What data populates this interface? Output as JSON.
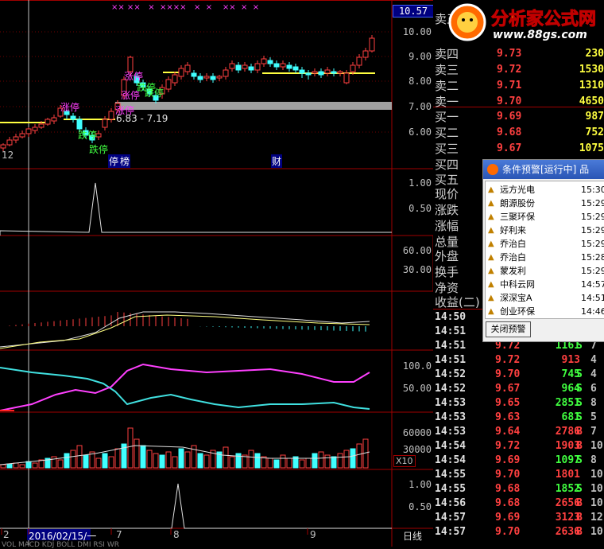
{
  "top_price_badge": "10.57",
  "top_markers": "×× ××   ×  ××××   ×  ×    ××  ×  ×",
  "main_axis": [
    "10.00",
    "9.00",
    "8.00",
    "7.00",
    "6.00"
  ],
  "vol_axis1": [
    "1.00",
    "0.50"
  ],
  "axis3": [
    "60.00",
    "30.00"
  ],
  "axis5": [
    "100.0",
    "50.00"
  ],
  "vol_axis": [
    "60000",
    "30000"
  ],
  "vol_unit": "X10",
  "axis7": [
    "1.00",
    "0.50"
  ],
  "chart_labels": {
    "range": "6.83 - 7.19",
    "left_num": "12",
    "tags": [
      "停",
      "涨停",
      "涨停",
      "涨停",
      "涨停",
      "跌停",
      "跌停",
      "跌停",
      "跌停",
      "涨停",
      "跌停"
    ],
    "bottom_tags": [
      "停",
      "榜",
      "财"
    ]
  },
  "bottom_bar": {
    "date": "2016/02/15/一",
    "ticks": [
      "2",
      "3",
      "7",
      "8",
      "9"
    ],
    "period": "日线",
    "indicators": "VOL  MACD  KDJ  BOLL  DMI  RSI  WR"
  },
  "quote": {
    "rows": [
      {
        "label": "卖五",
        "price": "",
        "vol": ""
      },
      {
        "label": "卖四",
        "price": "9.73",
        "vol": "230"
      },
      {
        "label": "卖三",
        "price": "9.72",
        "vol": "1530"
      },
      {
        "label": "卖二",
        "price": "9.71",
        "vol": "1310"
      },
      {
        "label": "卖一",
        "price": "9.70",
        "vol": "4650"
      },
      {
        "label": "买一",
        "price": "9.69",
        "vol": "987"
      },
      {
        "label": "买二",
        "price": "9.68",
        "vol": "752"
      },
      {
        "label": "买三",
        "price": "9.67",
        "vol": "1075"
      },
      {
        "label": "买四",
        "price": "",
        "vol": ""
      },
      {
        "label": "买五",
        "price": "",
        "vol": ""
      },
      {
        "label": "现价",
        "price": "",
        "vol": ""
      },
      {
        "label": "涨跌",
        "price": "",
        "vol": ""
      },
      {
        "label": "涨幅",
        "price": "",
        "vol": ""
      },
      {
        "label": "总量",
        "price": "",
        "vol": ""
      },
      {
        "label": "外盘",
        "price": "",
        "vol": ""
      },
      {
        "label": "换手",
        "price": "",
        "vol": ""
      },
      {
        "label": "净资",
        "price": "",
        "vol": ""
      },
      {
        "label": "收益(二)",
        "price": "",
        "vol": ""
      }
    ],
    "ticks": [
      {
        "time": "14:50",
        "price": "",
        "vol": "",
        "bs": "",
        "n": ""
      },
      {
        "time": "14:51",
        "price": "",
        "vol": "",
        "bs": "",
        "n": ""
      },
      {
        "time": "14:51",
        "price": "9.72",
        "vol": "1161",
        "bs": "S",
        "n": "7"
      },
      {
        "time": "14:51",
        "price": "9.72",
        "vol": "913",
        "bs": "",
        "n": "4"
      },
      {
        "time": "14:52",
        "price": "9.70",
        "vol": "745",
        "bs": "S",
        "n": "4"
      },
      {
        "time": "14:52",
        "price": "9.67",
        "vol": "964",
        "bs": "S",
        "n": "6"
      },
      {
        "time": "14:53",
        "price": "9.65",
        "vol": "2851",
        "bs": "S",
        "n": "8"
      },
      {
        "time": "14:53",
        "price": "9.63",
        "vol": "681",
        "bs": "S",
        "n": "5"
      },
      {
        "time": "14:53",
        "price": "9.64",
        "vol": "2786",
        "bs": "B",
        "n": "7"
      },
      {
        "time": "14:54",
        "price": "9.72",
        "vol": "1903",
        "bs": "B",
        "n": "10"
      },
      {
        "time": "14:54",
        "price": "9.69",
        "vol": "1097",
        "bs": "S",
        "n": "8"
      },
      {
        "time": "14:55",
        "price": "9.70",
        "vol": "1801",
        "bs": "",
        "n": "10"
      },
      {
        "time": "14:55",
        "price": "9.68",
        "vol": "1852",
        "bs": "S",
        "n": "10"
      },
      {
        "time": "14:56",
        "price": "9.68",
        "vol": "2656",
        "bs": "B",
        "n": "10"
      },
      {
        "time": "14:57",
        "price": "9.69",
        "vol": "3123",
        "bs": "B",
        "n": "12"
      },
      {
        "time": "14:57",
        "price": "9.70",
        "vol": "2636",
        "bs": "B",
        "n": "10"
      }
    ]
  },
  "popup": {
    "title": "条件预警[运行中] 品",
    "items": [
      {
        "name": "远方光电",
        "time": "15:30"
      },
      {
        "name": "朗源股份",
        "time": "15:29"
      },
      {
        "name": "三聚环保",
        "time": "15:29"
      },
      {
        "name": "好利来",
        "time": "15:29"
      },
      {
        "name": "乔治白",
        "time": "15:29"
      },
      {
        "name": "乔治白",
        "time": "15:28"
      },
      {
        "name": "蒙发利",
        "time": "15:29"
      },
      {
        "name": "中科云网",
        "time": "14:57"
      },
      {
        "name": "深深宝A",
        "time": "14:51"
      },
      {
        "name": "创业环保",
        "time": "14:46"
      }
    ],
    "close_label": "关闭预警"
  },
  "logo": {
    "title": "分析家公式网",
    "url": "www.88gs.com"
  },
  "colors": {
    "up": "#ff4040",
    "down": "#40ffff",
    "price_line": "#ffff40",
    "magenta": "#ff40ff",
    "cyan": "#40e0e0"
  }
}
